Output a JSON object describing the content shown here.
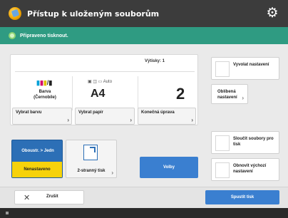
{
  "header": {
    "title": "Přístup k uloženým souborům",
    "settings_icon": "gear-icon"
  },
  "status": {
    "message": "Připraveno tisknout."
  },
  "settings": {
    "copies_label": "Výtisky: 1",
    "color_mode_line1": "Barva",
    "color_mode_line2": "(Černobíle)",
    "paper_options": "Auto",
    "paper_size": "A4",
    "copies_value": "2",
    "select_color_button": "Vybrat barvu",
    "select_paper_button": "Vybrat papír",
    "finishing_button": "Konečná úprava"
  },
  "side": {
    "recall_settings": "Vyvolat nastavení",
    "favorite_settings": "Oblíbená nastavení",
    "merge_files": "Sloučit soubory pro tisk",
    "restore_defaults": "Obnovit výchozí nastavení"
  },
  "bottom": {
    "duplex_label": "Oboustr. > Jedn",
    "duplex_value": "Nenastaveno",
    "layout_label": "2-stranný tisk",
    "options_button": "Volby"
  },
  "footer": {
    "cancel": "Zrušit",
    "start": "Spustit tisk"
  },
  "colors": {
    "title_bar": "#3c3c3c",
    "status_bar": "#2f9b82",
    "accent_blue": "#3a7fd0",
    "duplex_highlight": "#f6d20b"
  }
}
